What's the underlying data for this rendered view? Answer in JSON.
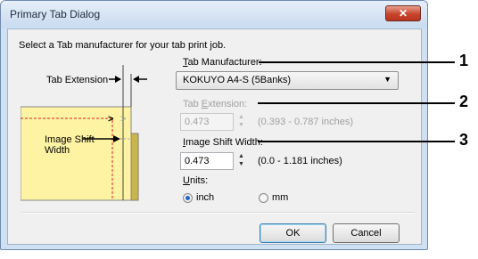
{
  "window": {
    "title": "Primary Tab Dialog",
    "close_glyph": "✕"
  },
  "dialog": {
    "instruction": "Select a Tab manufacturer for your tab print job.",
    "illustration": {
      "tab_extension_label": "Tab Extension",
      "image_shift_label_line1": "Image Shift",
      "image_shift_label_line2": "Width"
    },
    "tab_manufacturer": {
      "label_prefix": "T",
      "label_rest": "ab Manufacturer:",
      "value": "KOKUYO A4-S (5Banks)"
    },
    "tab_extension": {
      "label_prefix": "Tab ",
      "label_ul": "E",
      "label_rest": "xtension:",
      "value": "0.473",
      "range": "(0.393 - 0.787 inches)",
      "enabled": false
    },
    "image_shift_width": {
      "label_prefix": "I",
      "label_rest": "mage Shift Width:",
      "value": "0.473",
      "range": "(0.0 - 1.181 inches)"
    },
    "units": {
      "label_prefix": "U",
      "label_rest": "nits:",
      "options": [
        "inch",
        "mm"
      ],
      "selected": "inch"
    },
    "buttons": {
      "ok": "OK",
      "cancel": "Cancel"
    }
  },
  "callouts": [
    "1",
    "2",
    "3"
  ],
  "colors": {
    "tab_fill": "#fdf3a3",
    "tab_outline": "#d92020",
    "tab_shade": "#c9b64a",
    "dialog_face": "#f0f0f0",
    "radio_selected": "#1f64c8"
  }
}
